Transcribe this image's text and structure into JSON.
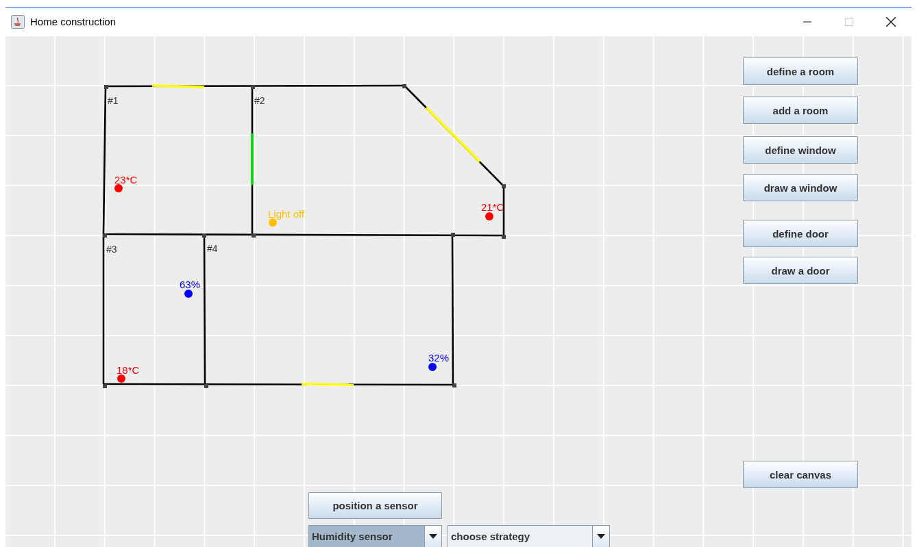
{
  "window": {
    "title": "Home construction"
  },
  "rooms": [
    {
      "label": "#1"
    },
    {
      "label": "#2"
    },
    {
      "label": "#3"
    },
    {
      "label": "#4"
    }
  ],
  "sensors": [
    {
      "reading": "23*C",
      "color": "#ff0000"
    },
    {
      "reading": "Light off",
      "color": "#ffc000"
    },
    {
      "reading": "21*C",
      "color": "#ff0000"
    },
    {
      "reading": "63%",
      "color": "#0000ff"
    },
    {
      "reading": "18*C",
      "color": "#ff0000"
    },
    {
      "reading": "32%",
      "color": "#0000ff"
    }
  ],
  "tool_buttons": [
    "define a room",
    "add a room",
    "define window",
    "draw a window",
    "define door",
    "draw a door",
    "clear canvas"
  ],
  "sensor_panel": {
    "button": "position a sensor",
    "sensor_type": {
      "value": "Humidity sensor",
      "focused": true
    },
    "strategy": {
      "value": "choose strategy",
      "focused": false
    }
  }
}
